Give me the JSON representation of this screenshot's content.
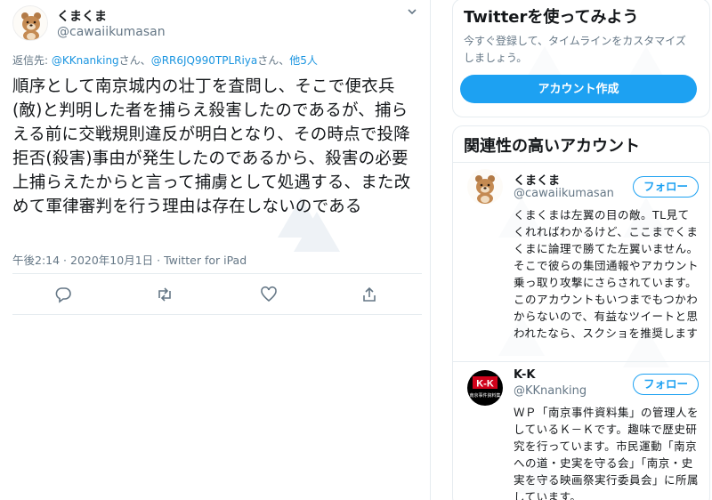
{
  "tweet": {
    "author_name": "くまくま",
    "author_handle": "@cawaiikumasan",
    "reply_prefix": "返信先: ",
    "reply_to_1": "@KKnanking",
    "reply_sep_1": "さん、",
    "reply_to_2": "@RR6JQ990TPLRiya",
    "reply_sep_2": "さん、",
    "reply_others": "他5人",
    "text": "順序として南京城内の壮丁を査問し、そこで便衣兵(敵)と判明した者を捕らえ殺害したのであるが、捕らえる前に交戦規則違反が明白となり、その時点で投降拒否(殺害)事由が発生したのであるから、殺害の必要上捕らえたからと言って捕虜として処遇する、また改めて軍律審判を行う理由は存在しないのである",
    "meta": "午後2:14 · 2020年10月1日 · Twitter for iPad"
  },
  "signup": {
    "title": "Twitterを使ってみよう",
    "description": "今すぐ登録して、タイムラインをカスタマイズしましょう。",
    "button_label": "アカウント作成"
  },
  "related": {
    "title": "関連性の高いアカウント",
    "accounts": [
      {
        "name": "くまくま",
        "handle": "@cawaiikumasan",
        "follow_label": "フォロー",
        "bio": "くまくまは左翼の目の敵。TL見てくれればわかるけど、ここまでくまくまに論理で勝てた左翼いません。そこで彼らの集団通報やアカウント乗っ取り攻撃にさらされています。このアカウントもいつまでもつかわからないので、有益なツイートと思われたなら、スクショを推奨します"
      },
      {
        "name": "K-K",
        "handle": "@KKnanking",
        "follow_label": "フォロー",
        "bio": "ＷＰ「南京事件資料集」の管理人をしているＫ－Ｋです。趣味で歴史研究を行っています。市民運動「南京への道・史実を守る会」「南京・史実を守る映画祭実行委員会」に所属しています。",
        "avatar_text": "K-K",
        "avatar_subtext": "南京事件資料集"
      }
    ]
  },
  "colors": {
    "accent": "#1da1f2",
    "link": "#1b95e0",
    "secondary_text": "#657786",
    "border": "#e6ecf0"
  },
  "icons": [
    "chevron-down-icon",
    "reply-icon",
    "retweet-icon",
    "like-icon",
    "share-icon",
    "bear-avatar",
    "kk-avatar"
  ]
}
